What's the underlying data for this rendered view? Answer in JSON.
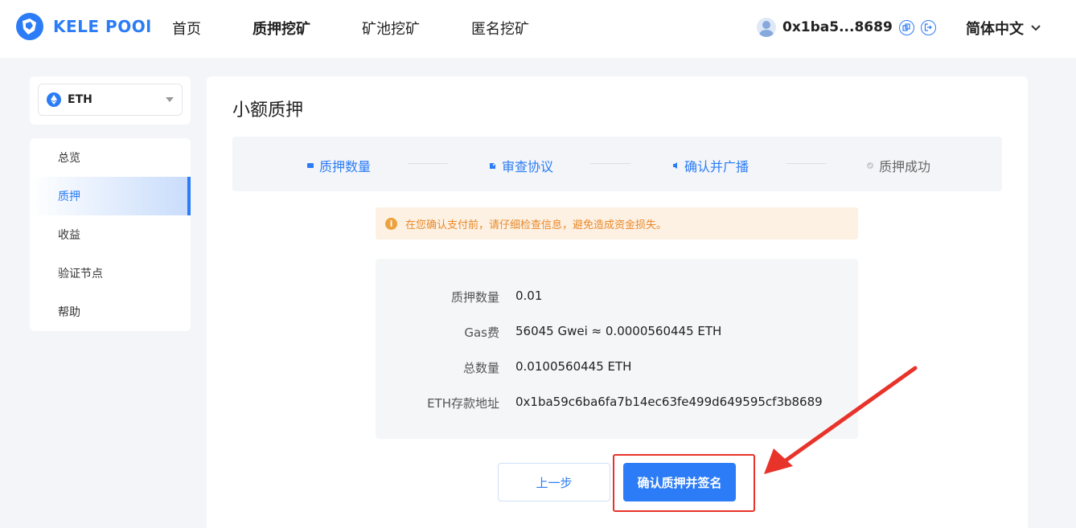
{
  "header": {
    "logo_text": "KELE POOl",
    "nav": [
      "首页",
      "质押挖矿",
      "矿池挖矿",
      "匿名挖矿"
    ],
    "account_address": "0x1ba5...8689",
    "language": "简体中文"
  },
  "sidebar": {
    "coin": "ETH",
    "items": [
      {
        "label": "总览",
        "active": false
      },
      {
        "label": "质押",
        "active": true
      },
      {
        "label": "收益",
        "active": false
      },
      {
        "label": "验证节点",
        "active": false
      },
      {
        "label": "帮助",
        "active": false
      }
    ]
  },
  "main": {
    "title": "小额质押",
    "steps": [
      {
        "label": "质押数量",
        "state": "done"
      },
      {
        "label": "审查协议",
        "state": "done"
      },
      {
        "label": "确认并广播",
        "state": "current"
      },
      {
        "label": "质押成功",
        "state": "pending"
      }
    ],
    "warning": "在您确认支付前，请仔细检查信息，避免造成资金损失。",
    "details": [
      {
        "label": "质押数量",
        "value": "0.01"
      },
      {
        "label": "Gas费",
        "value": "56045 Gwei ≈ 0.0000560445 ETH"
      },
      {
        "label": "总数量",
        "value": "0.0100560445 ETH"
      },
      {
        "label": "ETH存款地址",
        "value": "0x1ba59c6ba6fa7b14ec63fe499d649595cf3b8689"
      }
    ],
    "back_label": "上一步",
    "confirm_label": "确认质押并签名"
  },
  "colors": {
    "accent": "#2b7cf6",
    "warning_bg": "#fdf1e3",
    "warning_text": "#e8892a",
    "annotation": "#e8332a"
  }
}
